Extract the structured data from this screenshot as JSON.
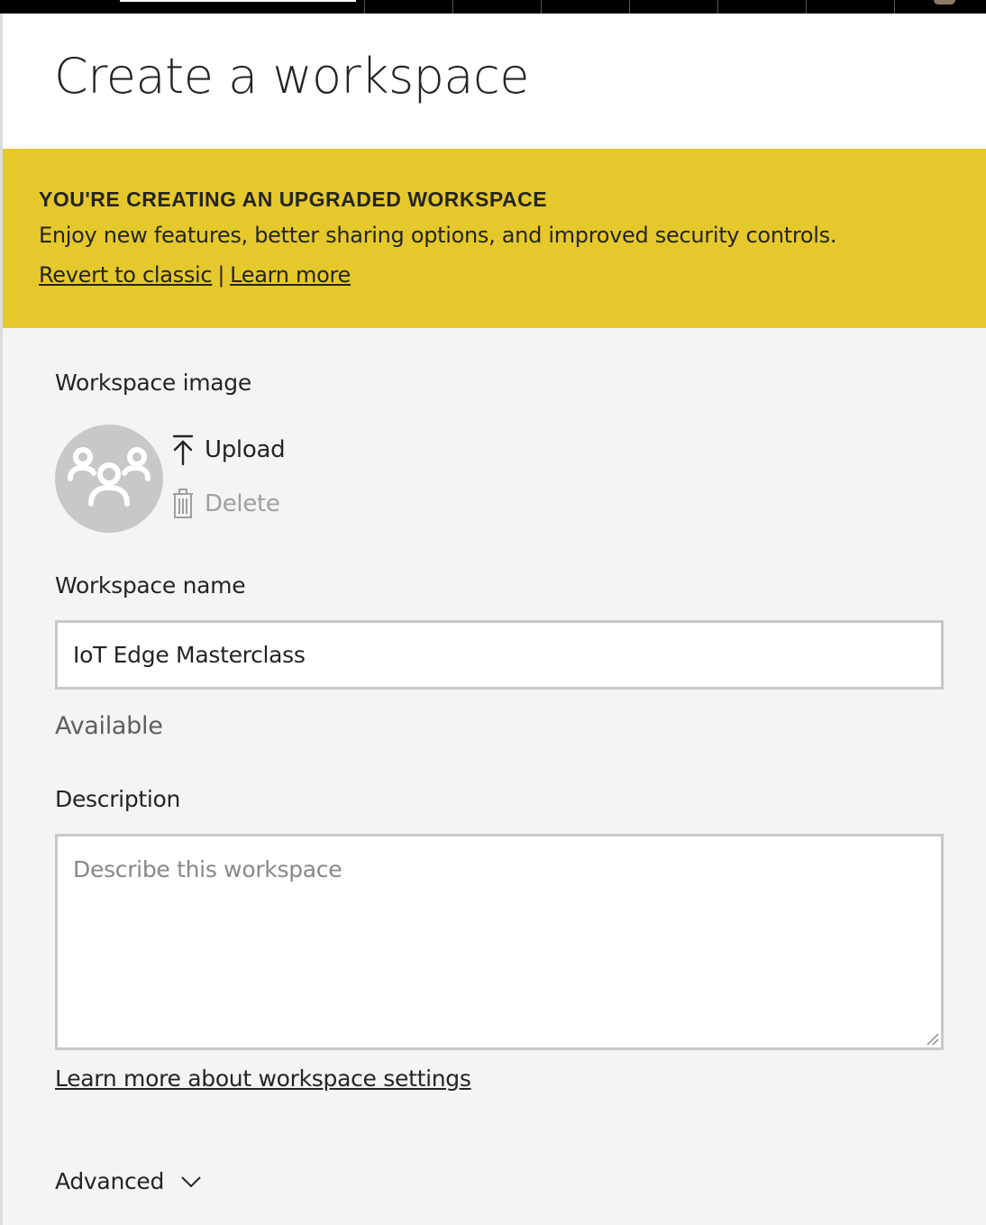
{
  "dialog": {
    "title": "Create a workspace"
  },
  "banner": {
    "heading": "YOU'RE CREATING AN UPGRADED WORKSPACE",
    "text": "Enjoy new features, better sharing options, and improved security controls.",
    "revert_link": "Revert to classic",
    "separator": "|",
    "learn_more_link": "Learn more",
    "background_color": "#e5c82b"
  },
  "workspace_image": {
    "label": "Workspace image",
    "avatar_icon": "people-group-icon",
    "upload_label": "Upload",
    "upload_icon": "upload-arrow-icon",
    "delete_label": "Delete",
    "delete_icon": "trash-icon"
  },
  "workspace_name": {
    "label": "Workspace name",
    "value": "IoT Edge Masterclass",
    "availability": "Available"
  },
  "description": {
    "label": "Description",
    "placeholder": "Describe this workspace",
    "value": ""
  },
  "settings_link": "Learn more about workspace settings",
  "advanced": {
    "label": "Advanced",
    "icon": "chevron-down-icon"
  }
}
